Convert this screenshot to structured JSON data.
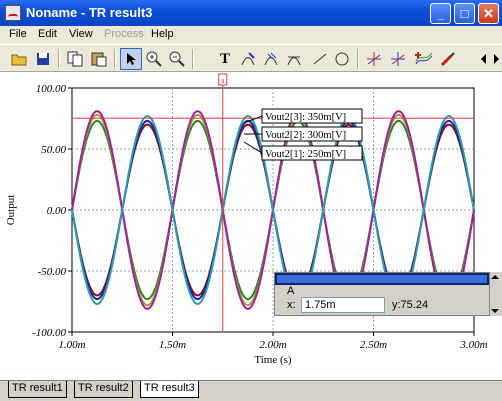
{
  "window": {
    "title": "Noname - TR result3",
    "min": "_",
    "max": "□",
    "close": "✕"
  },
  "menu": {
    "file": "File",
    "edit": "Edit",
    "view": "View",
    "process": "Process",
    "help": "Help"
  },
  "toolbar": {
    "icons": [
      "open-folder-icon",
      "save-icon",
      "copy-icon",
      "paste-icon",
      "pointer-icon",
      "zoom-in-icon",
      "zoom-out-100-icon",
      "text-icon",
      "label-icon",
      "label-multi-icon",
      "label-line-icon",
      "line-icon",
      "circle-icon",
      "cursor-a-icon",
      "cursor-b-icon",
      "add-curve-icon",
      "probe-icon",
      "scroll-arrows-icon"
    ],
    "pressed": "pointer-icon"
  },
  "tabs": [
    "TR result1",
    "TR result2",
    "TR result3"
  ],
  "active_tab": "TR result3",
  "cursor_panel": {
    "name": "A",
    "x_label": "x:",
    "x_value": "1.75m",
    "y_label": "y:75.24"
  },
  "chart_data": {
    "type": "line",
    "xlabel": "Time (s)",
    "ylabel": "Output",
    "xlim": [
      1.0,
      3.0
    ],
    "ylim": [
      -100,
      100
    ],
    "x_ticks": [
      "1.00m",
      "1.50m",
      "2.00m",
      "2.50m",
      "3.00m"
    ],
    "y_ticks": [
      "100.00",
      "50.00",
      "0.00",
      "-50.00",
      "-100.00"
    ],
    "grid": true,
    "frequency_khz": 2,
    "series": [
      {
        "name": "Vout2[1]: 250m[V]",
        "amplitude": 73,
        "color": "#208820"
      },
      {
        "name": "Vout2[2]: 300m[V]",
        "amplitude": 78,
        "color": "#a89c28"
      },
      {
        "name": "Vout2[3]: 350m[V]",
        "amplitude": 81,
        "color": "#a020a0"
      },
      {
        "name": "",
        "amplitude": 70,
        "color": "#8b1010",
        "phase_inverted": true
      },
      {
        "name": "",
        "amplitude": 73,
        "color": "#2020b0",
        "phase_inverted": true
      },
      {
        "name": "",
        "amplitude": 77,
        "color": "#2aa0a8",
        "phase_inverted": true
      }
    ],
    "labels": [
      {
        "text": "Vout2[3]: 350m[V]"
      },
      {
        "text": "Vout2[2]: 300m[V]"
      },
      {
        "text": "Vout2[1]: 250m[V]"
      }
    ],
    "cursor": {
      "name": "a",
      "x": 1.75,
      "y": 75.24,
      "color": "#e04040"
    }
  }
}
